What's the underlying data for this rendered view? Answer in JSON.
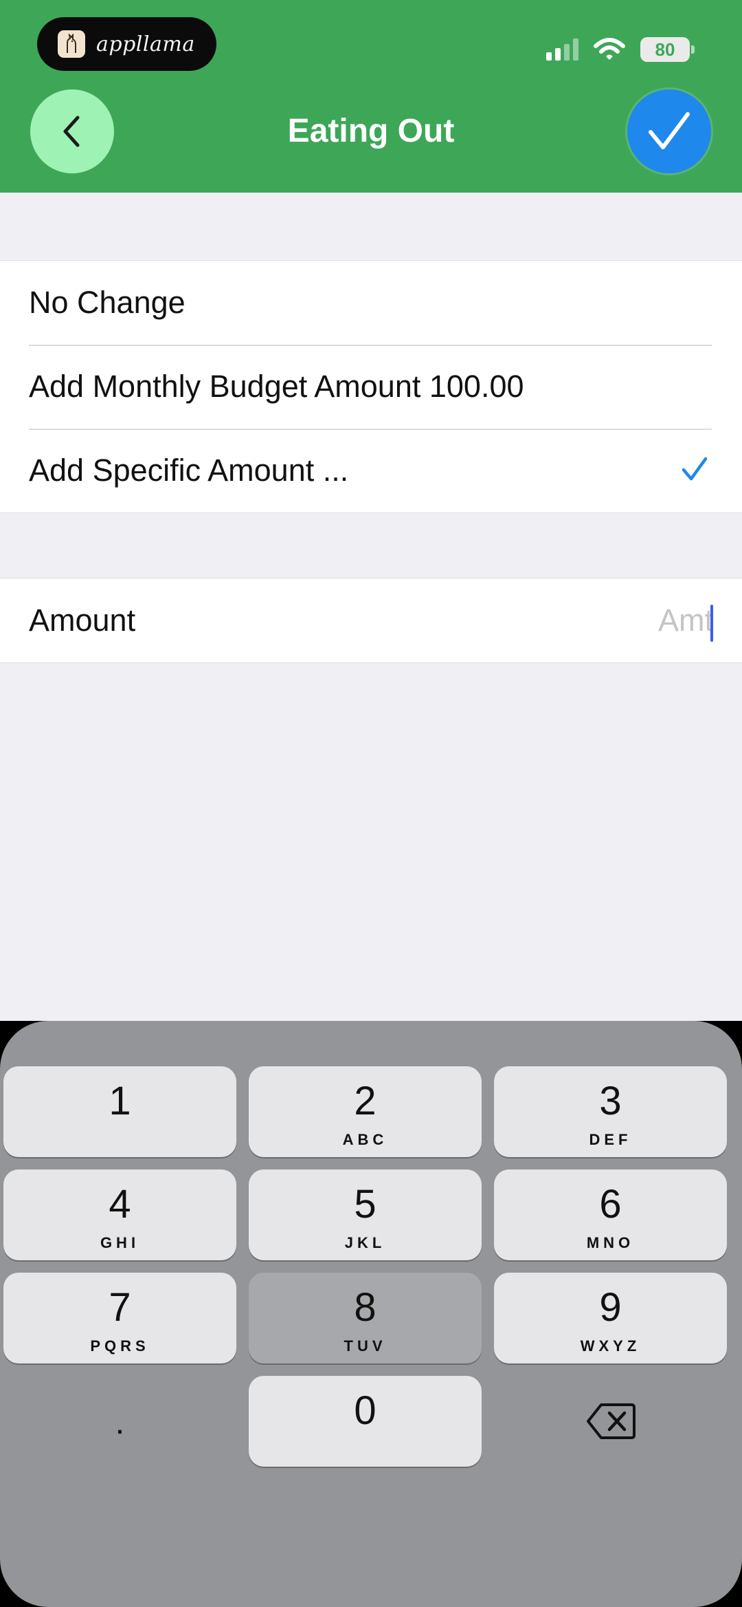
{
  "status_bar": {
    "app_brand": "appllama",
    "battery_level": "80"
  },
  "header": {
    "title": "Eating Out"
  },
  "options": [
    {
      "label": "No Change",
      "selected": false
    },
    {
      "label": "Add Monthly Budget Amount 100.00",
      "selected": false
    },
    {
      "label": "Add Specific Amount ...",
      "selected": true
    }
  ],
  "amount_field": {
    "label": "Amount",
    "placeholder": "Amt",
    "value": ""
  },
  "keypad": {
    "keys": [
      {
        "digit": "1",
        "letters": ""
      },
      {
        "digit": "2",
        "letters": "ABC"
      },
      {
        "digit": "3",
        "letters": "DEF"
      },
      {
        "digit": "4",
        "letters": "GHI"
      },
      {
        "digit": "5",
        "letters": "JKL"
      },
      {
        "digit": "6",
        "letters": "MNO"
      },
      {
        "digit": "7",
        "letters": "PQRS"
      },
      {
        "digit": "8",
        "letters": "TUV"
      },
      {
        "digit": "9",
        "letters": "WXYZ"
      },
      {
        "digit": "0",
        "letters": ""
      }
    ],
    "decimal": ".",
    "pressed_key": "8"
  },
  "colors": {
    "header_green": "#3da757",
    "back_button": "#9ef2b3",
    "accent_blue": "#1f88ec"
  },
  "icons": {
    "back": "chevron-left-icon",
    "confirm": "checkmark-icon",
    "selected": "checkmark-icon",
    "delete": "backspace-icon"
  }
}
